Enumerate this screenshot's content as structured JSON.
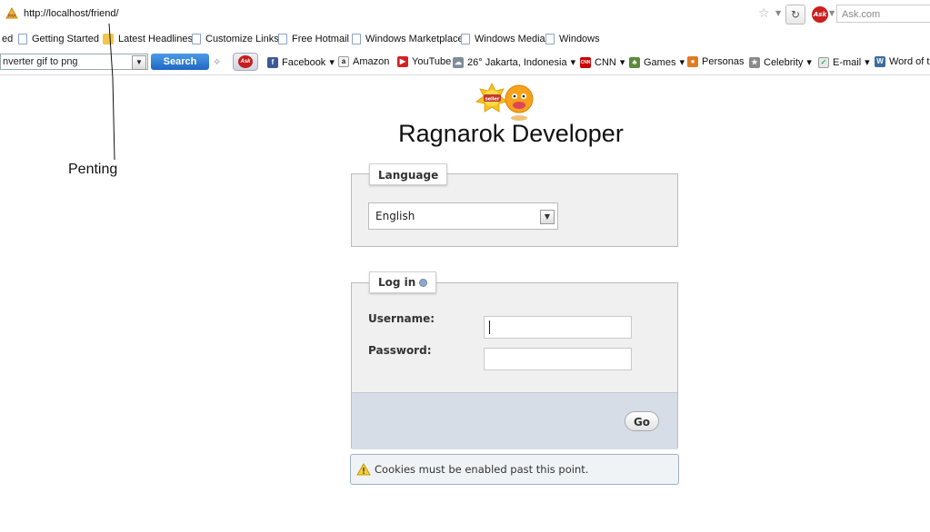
{
  "browser": {
    "url": "http://localhost/friend/",
    "search_engine_placeholder": "Ask.com",
    "ask_label": "Ask"
  },
  "bookmarks": [
    {
      "label": "ed"
    },
    {
      "label": "Getting Started"
    },
    {
      "label": "Latest Headlines"
    },
    {
      "label": "Customize Links"
    },
    {
      "label": "Free Hotmail"
    },
    {
      "label": "Windows Marketplace"
    },
    {
      "label": "Windows Media"
    },
    {
      "label": "Windows"
    }
  ],
  "toolbar": {
    "search_value": "nverter gif to png",
    "search_button": "Search",
    "items": [
      {
        "label": "Facebook",
        "icon": "facebook-icon"
      },
      {
        "label": "Amazon",
        "icon": "amazon-icon"
      },
      {
        "label": "YouTube",
        "icon": "youtube-icon"
      },
      {
        "label": "26° Jakarta, Indonesia",
        "icon": "weather-icon"
      },
      {
        "label": "CNN",
        "icon": "cnn-icon"
      },
      {
        "label": "Games",
        "icon": "games-icon"
      },
      {
        "label": "Personas",
        "icon": "personas-icon"
      },
      {
        "label": "Celebrity",
        "icon": "celebrity-icon"
      },
      {
        "label": "E-mail",
        "icon": "email-icon"
      },
      {
        "label": "Word of t",
        "icon": "word-icon"
      }
    ]
  },
  "annotation": {
    "text": "Penting"
  },
  "page": {
    "logo_text": "seller",
    "title": "Ragnarok Developer",
    "language": {
      "legend": "Language",
      "selected": "English"
    },
    "login": {
      "legend": "Log in",
      "username_label": "Username:",
      "password_label": "Password:",
      "go_label": "Go"
    },
    "notice": "Cookies must be enabled past this point."
  },
  "colors": {
    "panel_bg": "#f0f0f0",
    "footer_bg": "#d6dde6",
    "search_button": "#2f7fd6"
  }
}
